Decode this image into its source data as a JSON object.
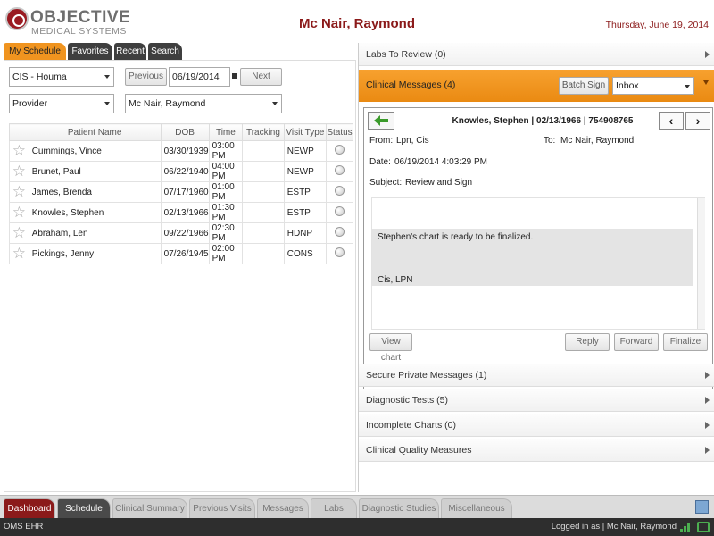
{
  "header": {
    "logo_line1": "OBJECTIVE",
    "logo_line2": "MEDICAL SYSTEMS",
    "patient_title": "Mc Nair, Raymond",
    "date": "Thursday, June 19, 2014"
  },
  "left_tabs": [
    "My Schedule",
    "Favorites",
    "Recent",
    "Search"
  ],
  "filters": {
    "location": "CIS - Houma",
    "previous_label": "Previous",
    "date_value": "06/19/2014",
    "next_label": "Next",
    "role": "Provider",
    "provider": "Mc Nair, Raymond"
  },
  "table": {
    "headers": [
      "Patient Name",
      "DOB",
      "Time",
      "Tracking",
      "Visit Type",
      "Status"
    ],
    "rows": [
      {
        "name": "Cummings, Vince",
        "dob": "03/30/1939",
        "time": "03:00 PM",
        "tracking": "",
        "visit": "NEWP"
      },
      {
        "name": "Brunet, Paul",
        "dob": "06/22/1940",
        "time": "04:00 PM",
        "tracking": "",
        "visit": "NEWP"
      },
      {
        "name": "James, Brenda",
        "dob": "07/17/1960",
        "time": "01:00 PM",
        "tracking": "",
        "visit": "ESTP"
      },
      {
        "name": "Knowles, Stephen",
        "dob": "02/13/1966",
        "time": "01:30 PM",
        "tracking": "",
        "visit": "ESTP"
      },
      {
        "name": "Abraham, Len",
        "dob": "09/22/1966",
        "time": "02:30 PM",
        "tracking": "",
        "visit": "HDNP"
      },
      {
        "name": "Pickings, Jenny",
        "dob": "07/26/1945",
        "time": "02:00 PM",
        "tracking": "",
        "visit": "CONS"
      }
    ]
  },
  "right": {
    "labs_to_review": "Labs To Review (0)",
    "clinical_messages": "Clinical Messages (4)",
    "batch_sign": "Batch Sign",
    "inbox": "Inbox",
    "message": {
      "patient_line": "Knowles, Stephen | 02/13/1966 | 754908765",
      "from_label": "From:",
      "from_value": "Lpn, Cis",
      "to_label": "To:",
      "to_value": "Mc Nair, Raymond",
      "date_label": "Date:",
      "date_value": "06/19/2014 4:03:29 PM",
      "subject_label": "Subject:",
      "subject_value": "Review and Sign",
      "body_line1": "Stephen's chart is ready to be finalized.",
      "body_line2": "Cis, LPN",
      "view_chart": "View chart",
      "reply": "Reply",
      "forward": "Forward",
      "finalize": "Finalize"
    },
    "secure_messages": "Secure Private Messages (1)",
    "diagnostic_tests": "Diagnostic Tests (5)",
    "incomplete_charts": "Incomplete Charts (0)",
    "quality_measures": "Clinical Quality Measures"
  },
  "bottom_tabs": [
    "Dashboard",
    "Schedule",
    "Clinical Summary",
    "Previous Visits",
    "Messages",
    "Labs",
    "Diagnostic Studies",
    "Miscellaneous"
  ],
  "status_bar": {
    "app_name": "OMS EHR",
    "logged_in": "Logged in as | Mc Nair, Raymond"
  },
  "colors": {
    "brand": "#8b1a1a",
    "accent": "#f0941f",
    "arrow_green": "#3a9a2a"
  }
}
